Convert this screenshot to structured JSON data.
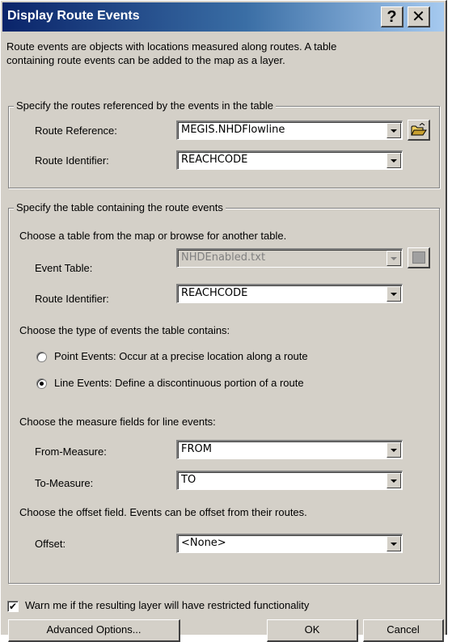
{
  "window": {
    "title": "Display Route Events",
    "help_label": "?",
    "close_label": "✕"
  },
  "description": {
    "line1": "Route events are objects with locations measured along routes. A table",
    "line2": "containing route events can be added to the map as a layer."
  },
  "routes_group": {
    "legend": "Specify the routes referenced by the events in the table",
    "route_reference_label": "Route Reference:",
    "route_reference_value": "MEGIS.NHDFlowline",
    "route_identifier_label": "Route Identifier:",
    "route_identifier_value": "REACHCODE",
    "browse_icon": "open-folder-icon"
  },
  "table_group": {
    "legend": "Specify the table containing the route events",
    "choose_table_text": "Choose a table from the map or browse for another table.",
    "event_table_label": "Event Table:",
    "event_table_value": "NHDEnabled.txt",
    "route_identifier_label": "Route Identifier:",
    "route_identifier_value": "REACHCODE",
    "event_type_text": "Choose the type of events the table contains:",
    "point_events_label": "Point Events: Occur at a precise location along a route",
    "line_events_label": "Line Events: Define a discontinuous portion of a route",
    "selected_event_type": "line",
    "measure_fields_text": "Choose the measure fields for line events:",
    "from_measure_label": "From-Measure:",
    "from_measure_value": "FROM",
    "to_measure_label": "To-Measure:",
    "to_measure_value": "TO",
    "offset_text": "Choose the offset field. Events can be offset from their routes.",
    "offset_label": "Offset:",
    "offset_value": "<None>"
  },
  "warn": {
    "label": "Warn me if the resulting layer will have restricted functionality",
    "checked": true,
    "check_mark": "✔"
  },
  "buttons": {
    "advanced": "Advanced Options...",
    "ok": "OK",
    "cancel": "Cancel"
  },
  "colors": {
    "face": "#d4d0c8",
    "title_start": "#0a246a",
    "title_end": "#a6caf0"
  }
}
